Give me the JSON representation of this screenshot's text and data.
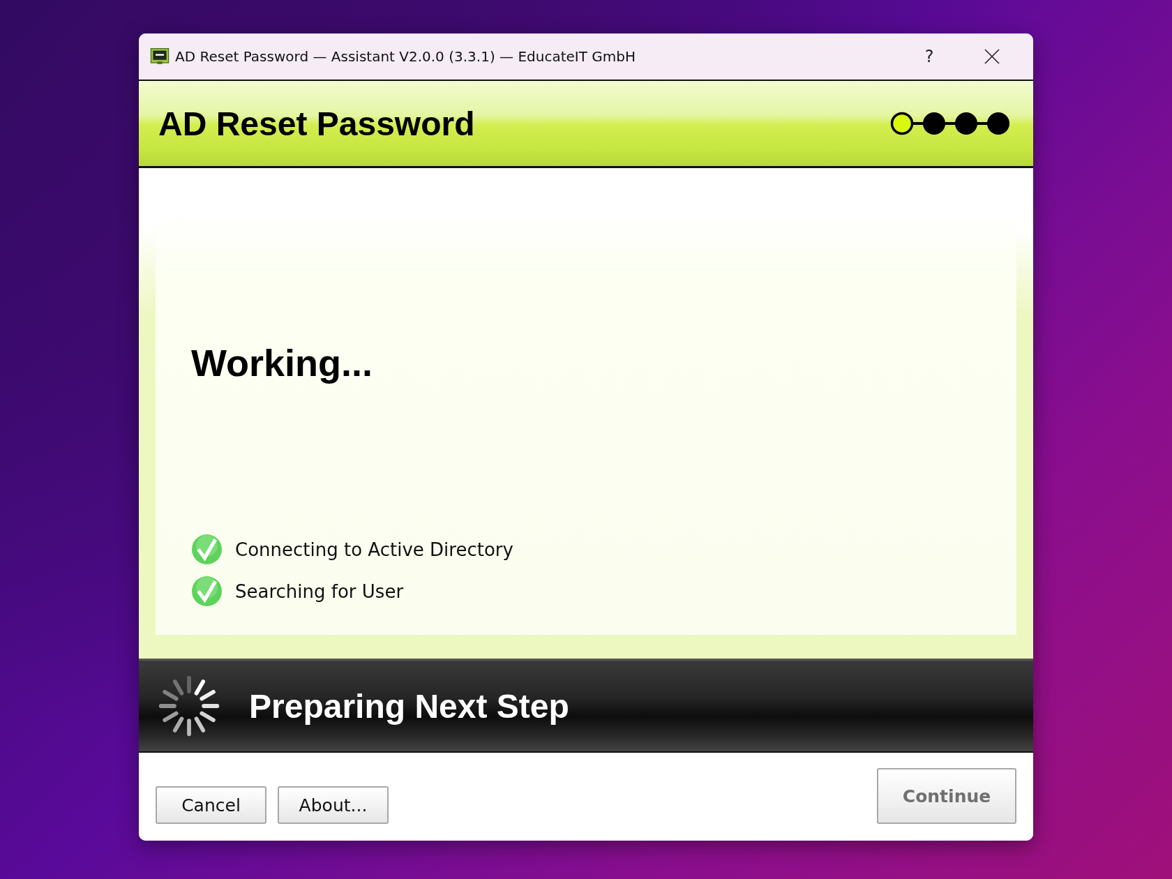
{
  "window": {
    "title": "AD Reset Password — Assistant V2.0.0 (3.3.1) — EducateIT GmbH",
    "help": "?"
  },
  "header": {
    "title": "AD Reset Password"
  },
  "steps": [
    {
      "selected": true
    },
    {
      "selected": false
    },
    {
      "selected": false
    },
    {
      "selected": false
    }
  ],
  "content": {
    "heading": "Working...",
    "tasks": [
      {
        "label": "Connecting to Active Directory",
        "done": true
      },
      {
        "label": "Searching for User",
        "done": true
      }
    ]
  },
  "status": {
    "text": "Preparing Next Step"
  },
  "buttons": [
    {
      "label": "Cancel",
      "disabled": false
    },
    {
      "label": "About...",
      "disabled": false
    }
  ],
  "primary_button": {
    "label": "Continue",
    "disabled": true
  }
}
